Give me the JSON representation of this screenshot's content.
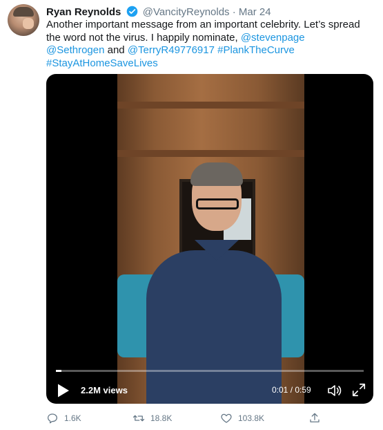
{
  "author": {
    "name": "Ryan Reynolds",
    "handle": "@VancityReynolds",
    "separator": "·",
    "date": "Mar 24"
  },
  "tweet": {
    "text_part1": "Another important message from an important celebrity. Let’s spread the word not the virus. I happily nominate, ",
    "mention1": "@stevenpage",
    "mention2": "@Sethrogen",
    "and": "and",
    "mention3": "@TerryR49776917",
    "hashtag1": "#PlankTheCurve",
    "hashtag2": "#StayAtHomeSaveLives"
  },
  "video": {
    "views": "2.2M views",
    "time": "0:01 / 0:59",
    "progress": 0.017
  },
  "actions": {
    "replies": "1.6K",
    "retweets": "18.8K",
    "likes": "103.8K"
  },
  "colors": {
    "link": "#1b95e0",
    "verified": "#1da1f2",
    "muted": "#657786"
  },
  "icons": [
    "verified-badge-icon",
    "play-icon",
    "volume-icon",
    "fullscreen-icon",
    "reply-icon",
    "retweet-icon",
    "like-icon",
    "share-icon"
  ]
}
